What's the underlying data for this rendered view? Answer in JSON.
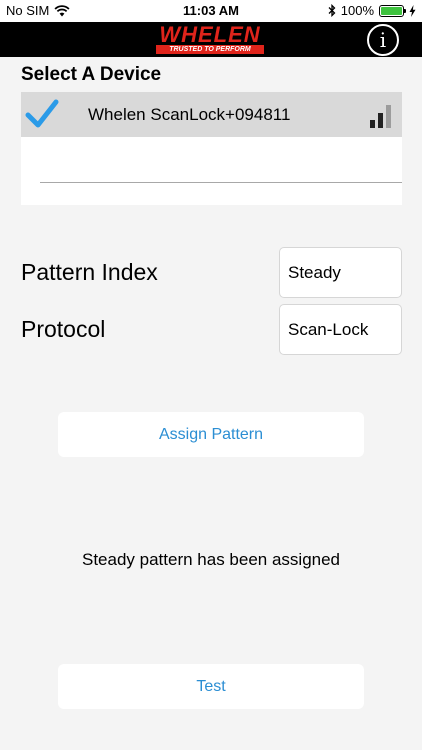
{
  "status_bar": {
    "carrier": "No SIM",
    "time": "11:03 AM",
    "battery_percent": "100%",
    "battery_color": "#3fc33f"
  },
  "header": {
    "logo_text": "WHELEN",
    "logo_tagline": "TRUSTED TO PERFORM",
    "info_icon": "i",
    "brand_color": "#e0241b"
  },
  "device_section": {
    "title": "Select A Device",
    "devices": [
      {
        "name": "Whelen ScanLock+094811",
        "selected": true,
        "icon": "checkmark-icon",
        "signal_icon": "signal-strength-icon",
        "signal_bars_active": 2,
        "signal_bars_total": 3
      }
    ]
  },
  "fields": {
    "pattern_index": {
      "label": "Pattern Index",
      "value": "Steady"
    },
    "protocol": {
      "label": "Protocol",
      "value": "Scan-Lock"
    }
  },
  "buttons": {
    "assign_label": "Assign Pattern",
    "test_label": "Test",
    "accent_color": "#2b8ed3"
  },
  "message": "Steady pattern has been assigned"
}
